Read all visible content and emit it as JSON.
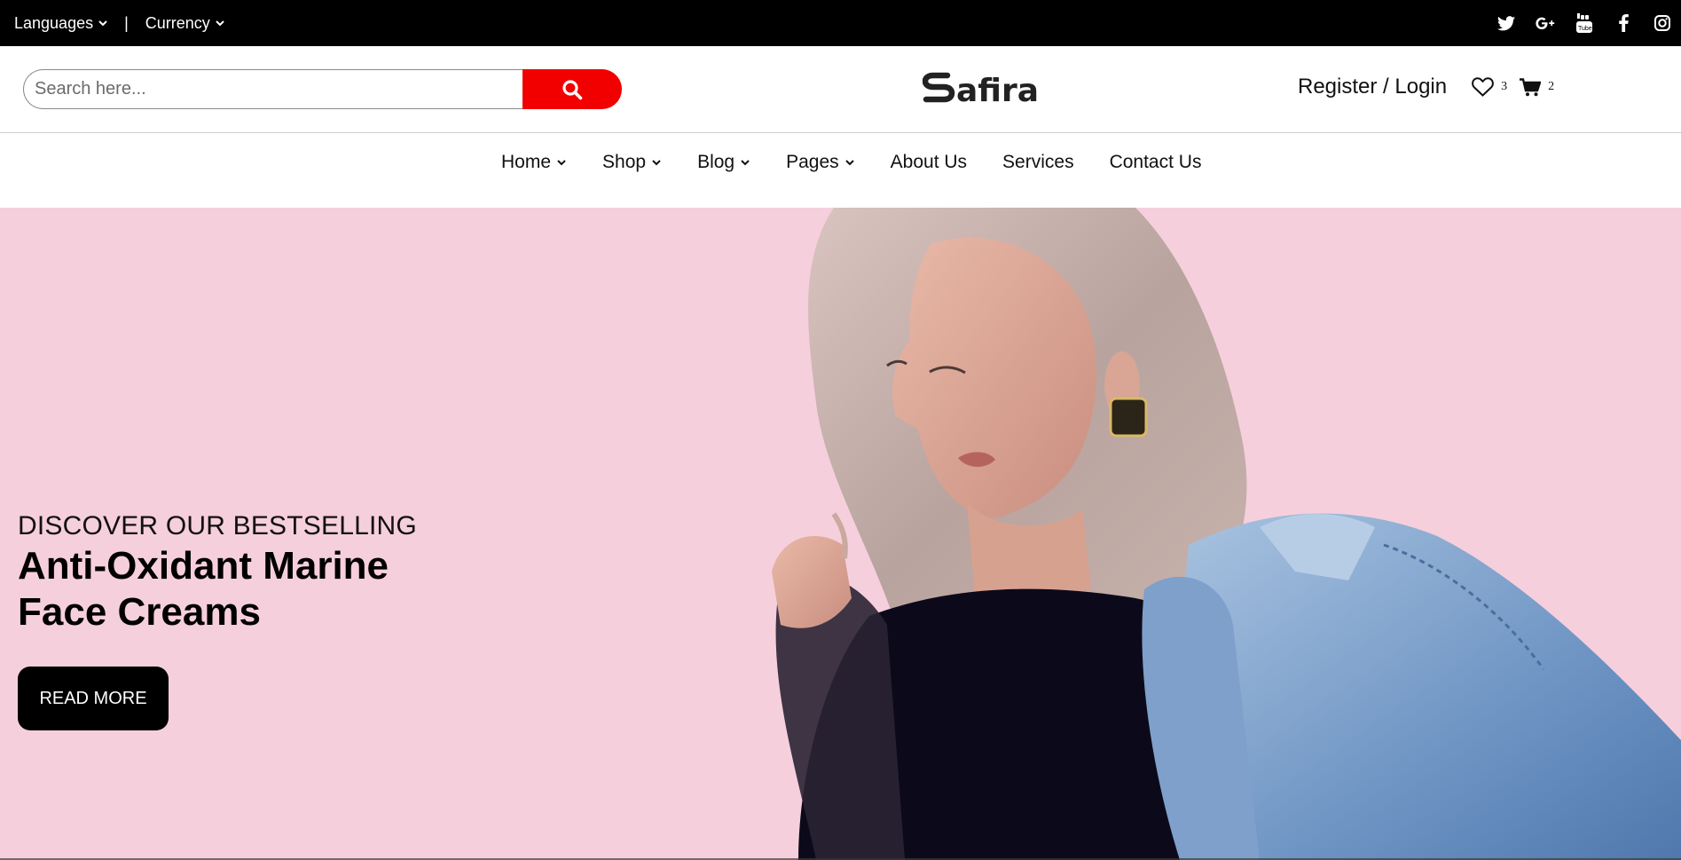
{
  "topbar": {
    "languages_label": "Languages",
    "separator": "|",
    "currency_label": "Currency",
    "social_icons": [
      "twitter-icon",
      "google-plus-icon",
      "youtube-icon",
      "facebook-icon",
      "instagram-icon"
    ]
  },
  "header": {
    "search_placeholder": "Search here...",
    "search_button_icon": "search-icon",
    "logo_text": "Safira",
    "account_link": "Register / Login",
    "wishlist_count": "3",
    "cart_count": "2"
  },
  "nav": {
    "items": [
      {
        "label": "Home",
        "dropdown": true
      },
      {
        "label": "Shop",
        "dropdown": true
      },
      {
        "label": "Blog",
        "dropdown": true
      },
      {
        "label": "Pages",
        "dropdown": true
      },
      {
        "label": "About Us",
        "dropdown": false
      },
      {
        "label": "Services",
        "dropdown": false
      },
      {
        "label": "Contact Us",
        "dropdown": false
      }
    ]
  },
  "hero": {
    "kicker": "DISCOVER OUR BESTSELLING",
    "title": "Anti-Oxidant Marine Face Creams",
    "button_label": "READ MORE",
    "background_color": "#f6cfdc"
  },
  "colors": {
    "accent": "#f20000",
    "topbar": "#000000",
    "button": "#000000"
  }
}
